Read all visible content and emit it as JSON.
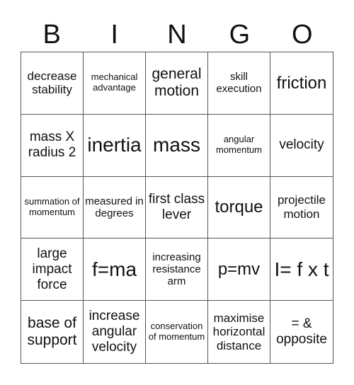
{
  "header": [
    "B",
    "I",
    "N",
    "G",
    "O"
  ],
  "cells": [
    "decrease stability",
    "mechanical advantage",
    "general motion",
    "skill execution",
    "friction",
    "mass X radius 2",
    "inertia",
    "mass",
    "angular momentum",
    "velocity",
    "summation of momentum",
    "measured in degrees",
    "first class lever",
    "torque",
    "projectile motion",
    "large impact force",
    "f=ma",
    "increasing resistance arm",
    "p=mv",
    "I= f x t",
    "base of support",
    "increase angular velocity",
    "conservation of momentum",
    "maximise horizontal distance",
    "= & opposite"
  ]
}
